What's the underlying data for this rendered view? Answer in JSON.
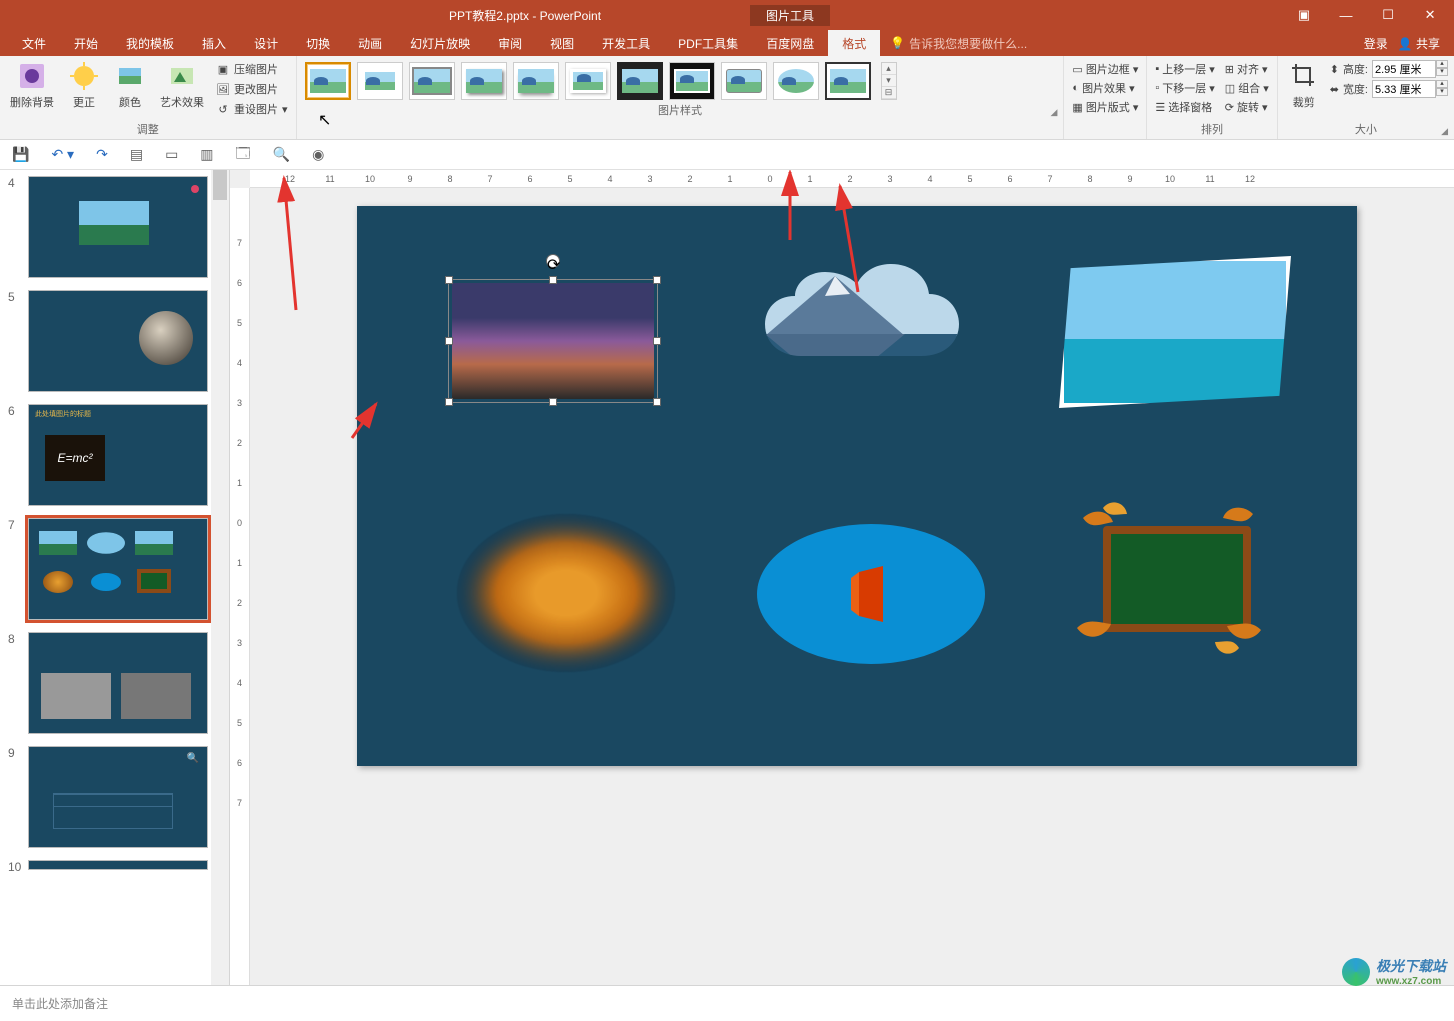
{
  "title": "PPT教程2.pptx - PowerPoint",
  "picture_tools": "图片工具",
  "win": {
    "login": "登录",
    "share": "共享"
  },
  "tabs": {
    "file": "文件",
    "home": "开始",
    "mytpl": "我的模板",
    "insert": "插入",
    "design": "设计",
    "trans": "切换",
    "anim": "动画",
    "slideshow": "幻灯片放映",
    "review": "审阅",
    "view": "视图",
    "dev": "开发工具",
    "pdf": "PDF工具集",
    "baidu": "百度网盘",
    "format": "格式"
  },
  "tellme_placeholder": "告诉我您想要做什么...",
  "ribbon": {
    "adjust": {
      "removebg": "删除背景",
      "correct": "更正",
      "color": "颜色",
      "art": "艺术效果",
      "compress": "压缩图片",
      "change": "更改图片",
      "reset": "重设图片",
      "group": "调整"
    },
    "picstyle_group": "图片样式",
    "picstyle": {
      "border": "图片边框",
      "effects": "图片效果",
      "layout": "图片版式"
    },
    "arrange": {
      "forward": "上移一层",
      "backward": "下移一层",
      "selpane": "选择窗格",
      "align": "对齐",
      "group": "组合",
      "rotate": "旋转",
      "grouplabel": "排列"
    },
    "size": {
      "crop": "裁剪",
      "h_label": "高度:",
      "h_val": "2.95 厘米",
      "w_label": "宽度:",
      "w_val": "5.33 厘米",
      "grouplabel": "大小"
    }
  },
  "ruler_h": [
    "12",
    "11",
    "10",
    "9",
    "8",
    "7",
    "6",
    "5",
    "4",
    "3",
    "2",
    "1",
    "0",
    "1",
    "2",
    "3",
    "4",
    "5",
    "6",
    "7",
    "8",
    "9",
    "10",
    "11",
    "12"
  ],
  "ruler_v": [
    "7",
    "6",
    "5",
    "4",
    "3",
    "2",
    "1",
    "0",
    "1",
    "2",
    "3",
    "4",
    "5",
    "6",
    "7"
  ],
  "thumbs": {
    "nums": [
      "4",
      "5",
      "6",
      "7",
      "8",
      "9",
      "10"
    ],
    "slide6_title": "此处填图片的标题",
    "slide6_formula": "E=mc²"
  },
  "notes_placeholder": "单击此处添加备注",
  "watermark": {
    "brand": "极光下载站",
    "url": "www.xz7.com"
  }
}
